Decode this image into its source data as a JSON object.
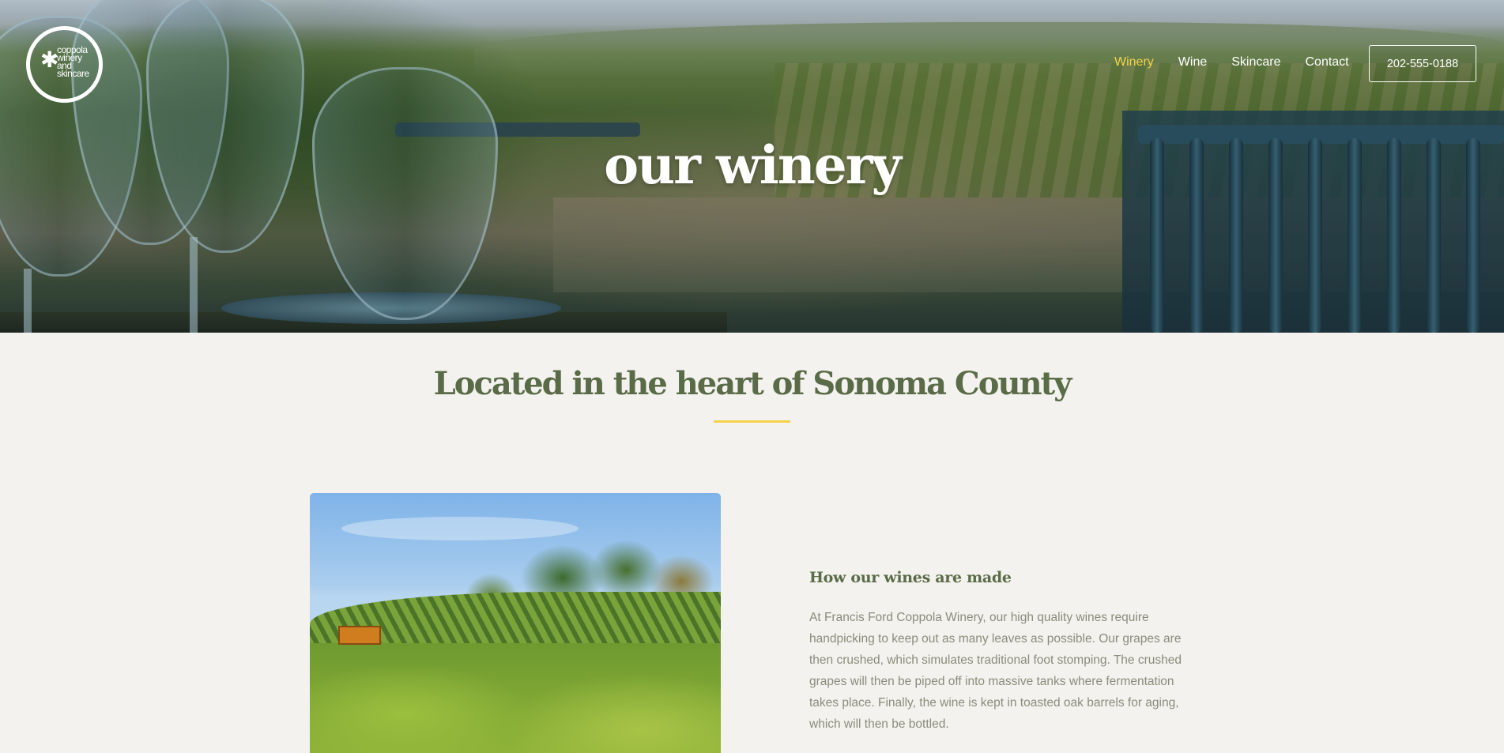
{
  "logo": {
    "lines": [
      "coppola",
      "winery",
      "and",
      "skincare"
    ],
    "star": "✱"
  },
  "nav": {
    "items": [
      {
        "label": "Winery",
        "active": true
      },
      {
        "label": "Wine",
        "active": false
      },
      {
        "label": "Skincare",
        "active": false
      },
      {
        "label": "Contact",
        "active": false
      }
    ],
    "phone": "202-555-0188"
  },
  "hero": {
    "title": "our winery"
  },
  "intro": {
    "title": "Located in the heart of Sonoma County"
  },
  "feature": {
    "title": "How our wines are made",
    "body": "At Francis Ford Coppola Winery, our high quality wines require handpicking to keep out as many leaves as possible. Our grapes are then crushed, which simulates traditional foot stomping. The crushed grapes will then be piped off into massive tanks where fermentation takes place. Finally, the wine is kept in toasted oak barrels for aging, which will then be bottled."
  },
  "colors": {
    "accent": "#f5d24a",
    "heading": "#5a6b48",
    "body_text": "#8b8b7c",
    "background": "#f3f2ee"
  }
}
